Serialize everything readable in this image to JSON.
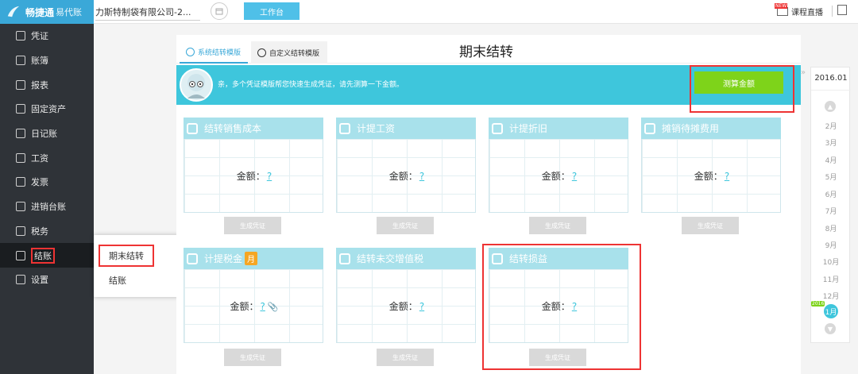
{
  "app": {
    "logo_text": "畅捷通",
    "logo_sub": "易代账"
  },
  "header": {
    "company": "力斯特制袋有限公司-2...",
    "workbench_label": "工作台",
    "live_label": "课程直播",
    "new_badge": "NEW"
  },
  "sidebar": {
    "items": [
      {
        "label": "凭证",
        "icon": "voucher-icon"
      },
      {
        "label": "账簿",
        "icon": "ledger-icon"
      },
      {
        "label": "报表",
        "icon": "report-icon"
      },
      {
        "label": "固定资产",
        "icon": "asset-icon"
      },
      {
        "label": "日记账",
        "icon": "journal-icon"
      },
      {
        "label": "工资",
        "icon": "salary-icon"
      },
      {
        "label": "发票",
        "icon": "invoice-icon"
      },
      {
        "label": "进销台账",
        "icon": "inventory-icon"
      },
      {
        "label": "税务",
        "icon": "tax-icon"
      },
      {
        "label": "结账",
        "icon": "close-books-icon"
      },
      {
        "label": "设置",
        "icon": "settings-icon"
      }
    ],
    "popup": {
      "item1": "期末结转",
      "item2": "结账"
    }
  },
  "main": {
    "tabs": [
      {
        "label": "系统结转模版"
      },
      {
        "label": "自定义结转模版"
      }
    ],
    "title": "期末结转",
    "banner_text": "亲，多个凭证模版帮您快速生成凭证，请先测算一下金额。",
    "calc_button": "测算金额",
    "amount_label": "金额：",
    "amount_value": "?",
    "gen_button": "生成凭证",
    "cards": [
      {
        "title": "结转销售成本"
      },
      {
        "title": "计提工资"
      },
      {
        "title": "计提折旧"
      },
      {
        "title": "摊销待摊费用"
      },
      {
        "title": "计提税金",
        "badge": "月"
      },
      {
        "title": "结转未交增值税"
      },
      {
        "title": "结转损益"
      }
    ]
  },
  "period": {
    "year_label": "2016.01",
    "months": [
      "2月",
      "3月",
      "4月",
      "5月",
      "6月",
      "7月",
      "8月",
      "9月",
      "10月",
      "11月",
      "12月"
    ],
    "selected": "1月",
    "selected_badge": "2016"
  },
  "colors": {
    "accent": "#3ec6dc",
    "green": "#7ed31a",
    "highlight": "#ee3333",
    "sidebar": "#2f3338"
  }
}
